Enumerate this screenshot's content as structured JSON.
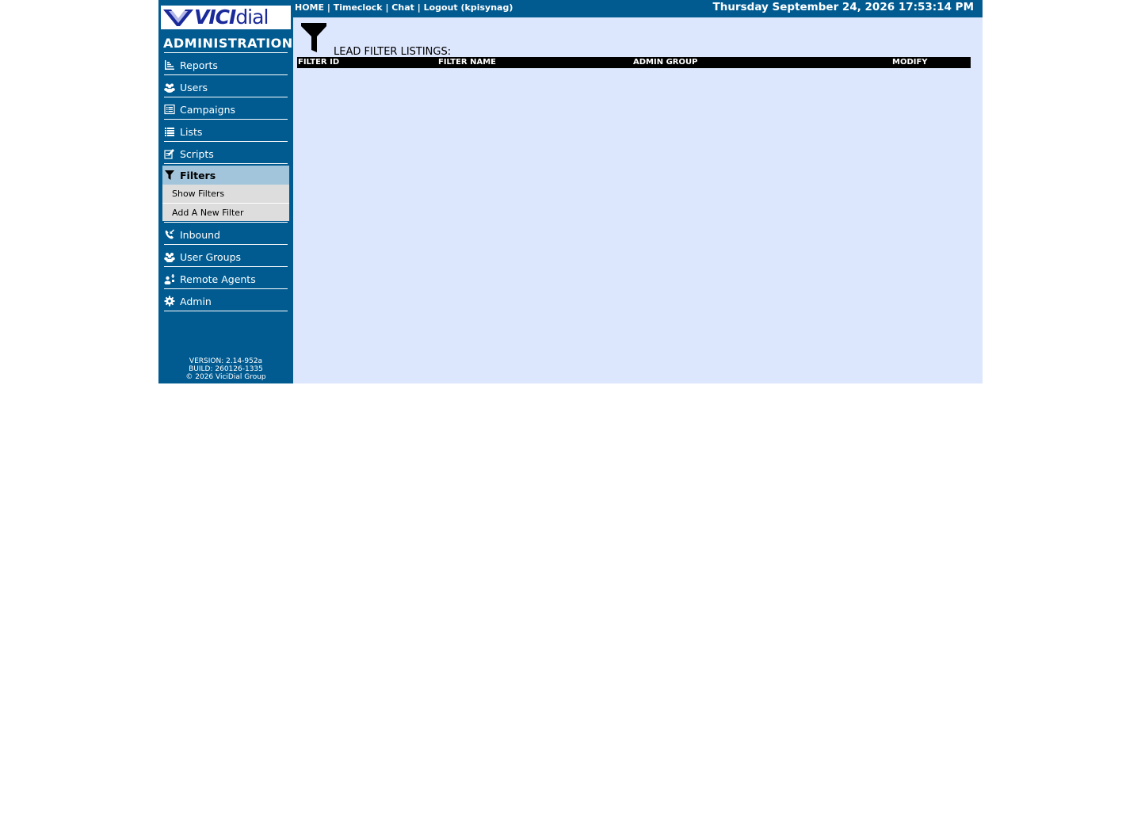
{
  "logo": {
    "text_vici": "VICI",
    "text_dial": "dial"
  },
  "sidebar": {
    "title": "ADMINISTRATION",
    "items": [
      {
        "label": "Reports",
        "icon": "reports-icon"
      },
      {
        "label": "Users",
        "icon": "users-icon"
      },
      {
        "label": "Campaigns",
        "icon": "campaigns-icon"
      },
      {
        "label": "Lists",
        "icon": "lists-icon"
      },
      {
        "label": "Scripts",
        "icon": "scripts-icon"
      },
      {
        "label": "Filters",
        "icon": "filter-icon",
        "active": true
      },
      {
        "label": "Inbound",
        "icon": "inbound-icon"
      },
      {
        "label": "User Groups",
        "icon": "user-groups-icon"
      },
      {
        "label": "Remote Agents",
        "icon": "remote-agents-icon"
      },
      {
        "label": "Admin",
        "icon": "gear-icon"
      }
    ],
    "subitems": [
      {
        "label": "Show Filters"
      },
      {
        "label": "Add A New Filter"
      }
    ],
    "footer": {
      "version": "VERSION: 2.14-952a",
      "build": "BUILD: 260126-1335",
      "copyright": "© 2026 ViciDial Group"
    }
  },
  "topbar": {
    "home": "HOME",
    "timeclock": "Timeclock",
    "chat": "Chat",
    "logout": "Logout (kpisynag)",
    "separator": " | ",
    "datetime": "Thursday September 24, 2026 17:53:14 PM"
  },
  "main": {
    "title": "LEAD FILTER LISTINGS:",
    "columns": [
      "FILTER ID",
      "FILTER NAME",
      "ADMIN GROUP",
      "MODIFY"
    ]
  },
  "colors": {
    "nav_bg": "#015b91",
    "main_bg": "#dce6fc",
    "active_item_bg": "#a3c5db",
    "submenu_bg": "#dddddd",
    "table_header_bg": "#000000"
  }
}
